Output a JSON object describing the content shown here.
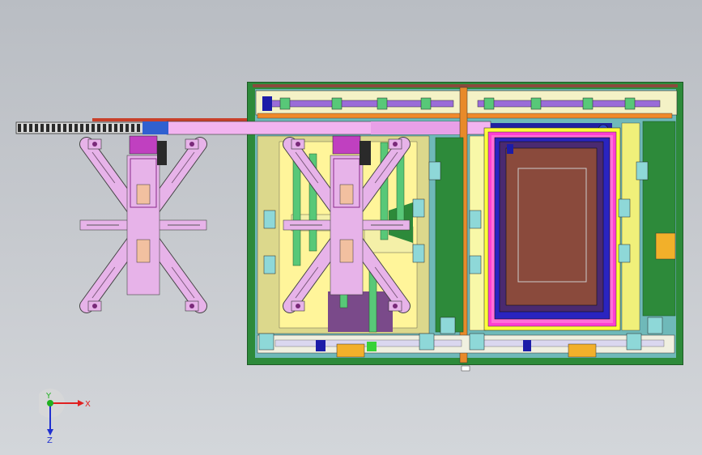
{
  "viewport": {
    "background_top": "#b9bdc3",
    "background_bottom": "#d3d6da"
  },
  "model": {
    "colors": {
      "frame_green": "#2d8a3a",
      "frame_dark": "#1e5a26",
      "cyan_plate": "#8ed8d8",
      "yellow_plate": "#f0f07a",
      "khaki_plate": "#dcd88c",
      "pink_gripper": "#e7b3e9",
      "magenta": "#ff3fd2",
      "brown_table": "#8a4a3c",
      "navy": "#1c1ca8",
      "orange_block": "#f2b02a",
      "chain_dark": "#2a2a2a",
      "red_beam": "#c8402a",
      "green_cyl": "#58c878",
      "blue_frame": "#3050d0",
      "yellow_bright": "#ffff3a"
    }
  },
  "triad": {
    "x_label": "X",
    "y_label": "Y",
    "z_label": "Z",
    "x_color": "#e02020",
    "y_color": "#20b020",
    "z_color": "#2030d0"
  }
}
